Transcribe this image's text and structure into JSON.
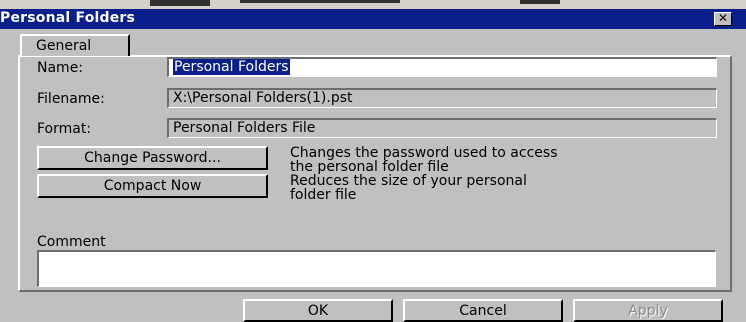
{
  "window": {
    "title": "Personal Folders",
    "close_glyph": "✕"
  },
  "tabs": [
    {
      "label": "General",
      "active": true
    }
  ],
  "form": {
    "name_label": "Name:",
    "name_value": "Personal Folders",
    "filename_label": "Filename:",
    "filename_value": "X:\\Personal Folders(1).pst",
    "format_label": "Format:",
    "format_value": "Personal Folders File",
    "comment_label": "Comment",
    "comment_value": ""
  },
  "actions": {
    "change_password_label": "Change Password...",
    "change_password_desc_line1": "Changes the password used to access",
    "change_password_desc_line2": "the personal folder file",
    "compact_now_label": "Compact Now",
    "compact_now_desc_line1": "Reduces the size of your personal",
    "compact_now_desc_line2": "folder file"
  },
  "footer": {
    "ok_label": "OK",
    "cancel_label": "Cancel",
    "apply_label": "Apply"
  },
  "colors": {
    "titlebar": "#0a1e8c",
    "dialog_face": "#c0c0c0",
    "selection": "#0a1e8c"
  }
}
